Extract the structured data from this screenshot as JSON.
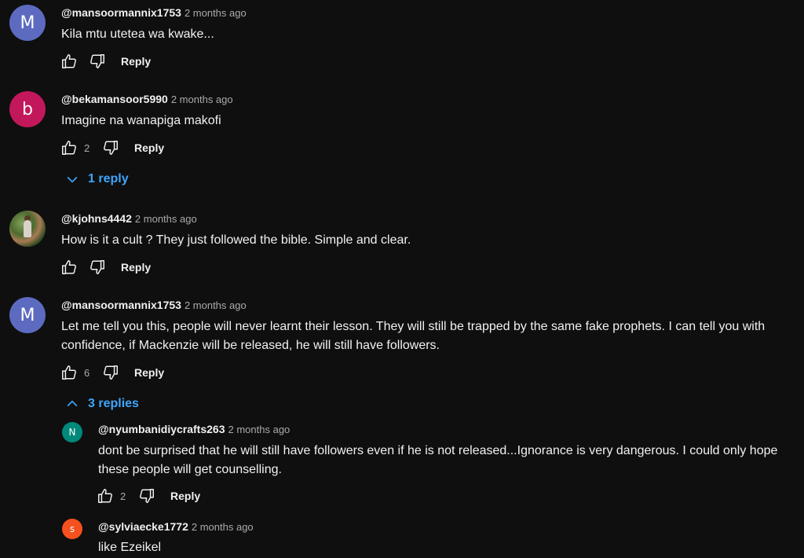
{
  "comments": [
    {
      "avatar_letter": "M",
      "avatar_color": "#5c6bc0",
      "author": "@mansoormannix1753",
      "time": "2 months ago",
      "text": "Kila mtu utetea wa kwake...",
      "likes": "",
      "reply_label": "Reply"
    },
    {
      "avatar_letter": "b",
      "avatar_color": "#c2185b",
      "author": "@bekamansoor5990",
      "time": "2 months ago",
      "text": "Imagine na wanapiga makofi",
      "likes": "2",
      "reply_label": "Reply",
      "replies_toggle": "1 reply"
    },
    {
      "avatar_letter": "",
      "avatar_color": "#4d6b2f",
      "author": "@kjohns4442",
      "time": "2 months ago",
      "text": "How is it a cult ? They just followed the bible. Simple and clear.",
      "likes": "",
      "reply_label": "Reply"
    },
    {
      "avatar_letter": "M",
      "avatar_color": "#5c6bc0",
      "author": "@mansoormannix1753",
      "time": "2 months ago",
      "text_lines": [
        "Let me tell you this, people will never learnt their lesson. They will still be trapped by the same fake prophets. I can tell you with",
        "confidence, if Mackenzie will be released, he will still have followers."
      ],
      "likes": "6",
      "reply_label": "Reply",
      "replies_toggle": "3 replies"
    }
  ],
  "replies": [
    {
      "avatar_letter": "N",
      "avatar_color": "#00897b",
      "author": "@nyumbanidiycrafts263",
      "time": "2 months ago",
      "text_lines": [
        "dont be surprised that he will still have followers even if he is not released...Ignorance is very dangerous. I could only hope",
        "these people will get counselling."
      ],
      "likes": "2",
      "reply_label": "Reply"
    },
    {
      "avatar_letter": "s",
      "avatar_color": "#f4511e",
      "author": "@sylviaecke1772",
      "time": "2 months ago",
      "text": "like Ezeikel"
    }
  ],
  "icons": {
    "like": "thumbs-up-icon",
    "dislike": "thumbs-down-icon",
    "expand": "chevron-down-icon",
    "collapse": "chevron-up-icon"
  },
  "colors": {
    "background": "#0f0f0f",
    "link": "#3ea6ff",
    "muted": "#aaaaaa"
  }
}
